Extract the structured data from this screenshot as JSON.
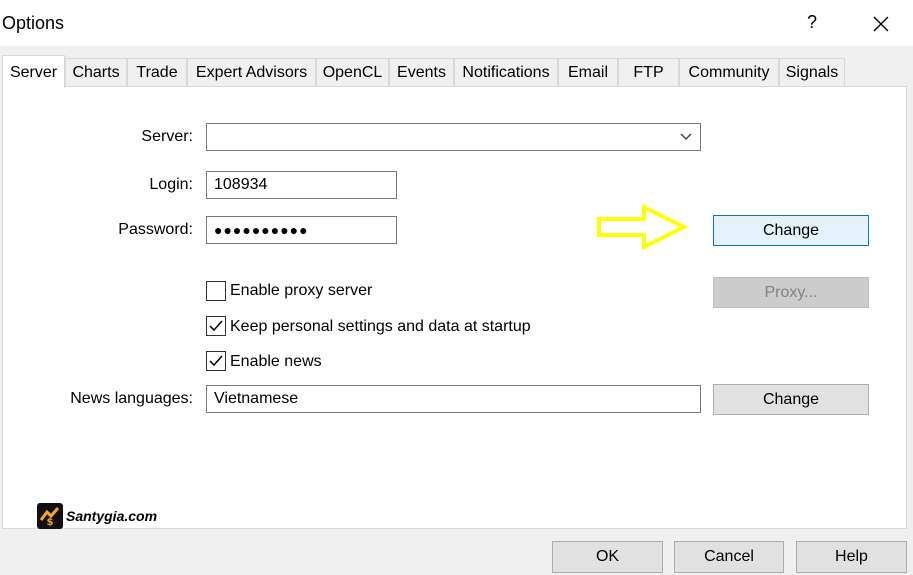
{
  "window": {
    "title": "Options",
    "help_label": "?",
    "close_icon": "close-icon"
  },
  "tabs": [
    {
      "label": "Server",
      "active": true
    },
    {
      "label": "Charts"
    },
    {
      "label": "Trade"
    },
    {
      "label": "Expert Advisors"
    },
    {
      "label": "OpenCL"
    },
    {
      "label": "Events"
    },
    {
      "label": "Notifications"
    },
    {
      "label": "Email"
    },
    {
      "label": "FTP"
    },
    {
      "label": "Community"
    },
    {
      "label": "Signals"
    }
  ],
  "server_tab": {
    "server_label": "Server:",
    "server_value": "",
    "login_label": "Login:",
    "login_value": "108934",
    "password_label": "Password:",
    "password_value": "●●●●●●●●●●",
    "change_password_button": "Change",
    "proxy_checkbox_label": "Enable proxy server",
    "proxy_checked": false,
    "proxy_button": "Proxy...",
    "keep_settings_label": "Keep personal settings and data at startup",
    "keep_settings_checked": true,
    "enable_news_label": "Enable news",
    "enable_news_checked": true,
    "news_languages_label": "News languages:",
    "news_languages_value": "Vietnamese",
    "change_languages_button": "Change"
  },
  "annotation": {
    "arrow_color": "#ffff00",
    "arrow_icon": "arrow-right-icon"
  },
  "watermark": {
    "text": "Santygia.com"
  },
  "footer": {
    "ok_label": "OK",
    "cancel_label": "Cancel",
    "help_label": "Help"
  }
}
